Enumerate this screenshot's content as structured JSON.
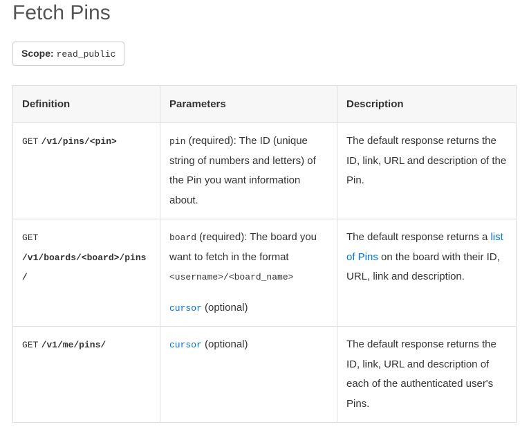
{
  "title": "Fetch Pins",
  "scope": {
    "label": "Scope:",
    "value": "read_public"
  },
  "table": {
    "headers": {
      "definition": "Definition",
      "parameters": "Parameters",
      "description": "Description"
    },
    "rows": [
      {
        "method": "GET",
        "path": "/v1/pins/<pin>",
        "params": [
          {
            "name": "pin",
            "required_text": " (required): ",
            "text_after": "The ID (unique string of numbers and letters) of the Pin you want information about."
          }
        ],
        "desc": [
          {
            "text_before": "The default response returns the ID, link, URL and description of the Pin."
          }
        ]
      },
      {
        "method": "GET",
        "path": "/v1/boards/<board>/pins/",
        "params": [
          {
            "name": "board",
            "required_text": " (required): ",
            "text_after": "The board you want to fetch in the format ",
            "mono_after": "<username>/<board_name>"
          },
          {
            "name_link": "cursor",
            "required_text": " (optional)"
          }
        ],
        "desc": [
          {
            "text_before": "The default response returns a ",
            "link": "list of Pins",
            "text_after": " on the board with their ID, URL, link and description."
          }
        ]
      },
      {
        "method": "GET",
        "path": "/v1/me/pins/",
        "params": [
          {
            "name_link": "cursor",
            "required_text": " (optional)"
          }
        ],
        "desc": [
          {
            "text_before": "The default response returns the ID, link, URL and description of each of the authenticated user's Pins."
          }
        ]
      }
    ]
  }
}
